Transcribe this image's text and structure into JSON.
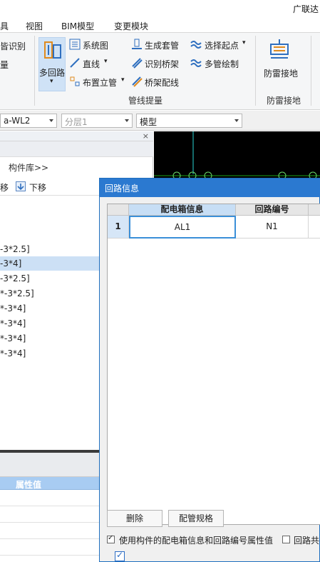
{
  "titlebar": {
    "brand": "广联达"
  },
  "menu": {
    "tab_partial": "具",
    "tab_view": "视图",
    "tab_bim": "BIM模型",
    "tab_convert": "变更模块"
  },
  "ribbon": {
    "partial_recognize": "皆识别",
    "partial_quantity": "量",
    "multi_loop": "多回路",
    "system_diagram": "系统图",
    "straight_line": "直线",
    "arrange_riser": "布置立管",
    "generate_sleeve": "生成套管",
    "recognize_bridge": "识别桥架",
    "bridge_wiring": "桥架配线",
    "select_start": "选择起点",
    "multi_draw": "多管绘制",
    "group_pipe_label": "管线提量",
    "lightning": "防雷接地",
    "group_lightning_label": "防雷接地"
  },
  "combos": {
    "layer_partial": "a-WL2",
    "sublayer": "分层1",
    "model": "模型"
  },
  "leftpanel": {
    "close": "×",
    "component_lib": "构件库>>",
    "move_up_partial": "移",
    "move_down": "下移",
    "items": [
      "-3*2.5]",
      "-3*4]",
      "-3*2.5]",
      "*-3*2.5]",
      "*-3*4]",
      "*-3*4]",
      "*-3*4]",
      "*-3*4]"
    ],
    "prop_value_header": "属性值"
  },
  "dialog": {
    "title": "回路信息",
    "columns": [
      "配电箱信息",
      "回路编号"
    ],
    "rows": [
      {
        "num": "1",
        "box": "AL1",
        "loop": "N1"
      }
    ],
    "delete": "删除",
    "pipe_spec": "配管规格",
    "use_component_info": "使用构件的配电箱信息和回路编号属性值",
    "loop_shared_partial": "回路共"
  }
}
